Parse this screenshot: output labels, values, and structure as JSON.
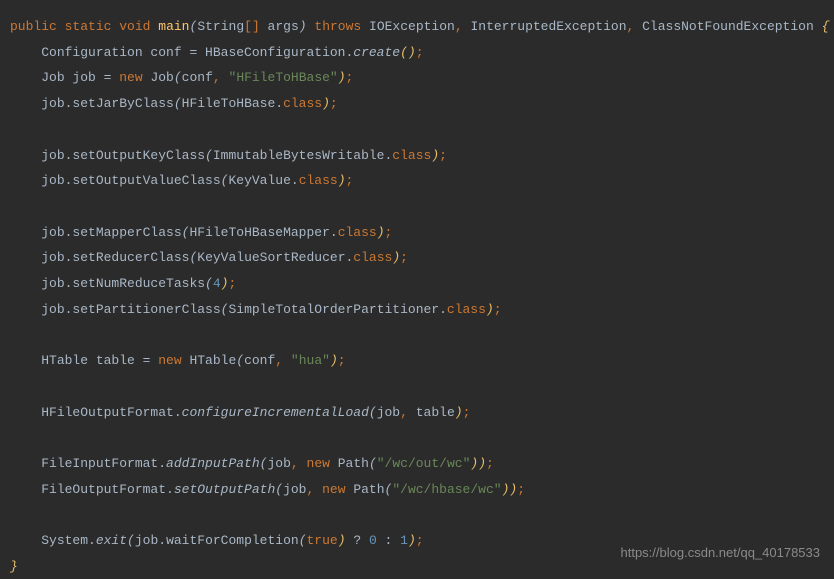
{
  "code": {
    "line1": {
      "public": "public",
      "static": "static",
      "void": "void",
      "main": "main",
      "string": "String",
      "br_open": "[",
      "br_close": "]",
      "args": " args",
      "throws": "throws",
      "ex1": "IOException",
      "ex2": "InterruptedException",
      "ex3": "ClassNotFoundException",
      "brace": "{"
    },
    "line2": {
      "p1": "Configuration conf = HBaseConfiguration.",
      "create": "create",
      "paren": "()"
    },
    "line3": {
      "p1": "Job job = ",
      "new": "new",
      "p2": " Job",
      "lp": "(",
      "conf": "conf",
      "comma": ", ",
      "str": "\"HFileToHBase\"",
      "rp": ")"
    },
    "line4": {
      "p1": "job.setJarByClass",
      "lp": "(",
      "p2": "HFileToHBase.",
      "cls": "class",
      "rp": ")"
    },
    "line5": {
      "p1": "job.setOutputKeyClass",
      "lp": "(",
      "p2": "ImmutableBytesWritable.",
      "cls": "class",
      "rp": ")"
    },
    "line6": {
      "p1": "job.setOutputValueClass",
      "lp": "(",
      "p2": "KeyValue.",
      "cls": "class",
      "rp": ")"
    },
    "line7": {
      "p1": "job.setMapperClass",
      "lp": "(",
      "p2": "HFileToHBaseMapper.",
      "cls": "class",
      "rp": ")"
    },
    "line8": {
      "p1": "job.setReducerClass",
      "lp": "(",
      "p2": "KeyValueSortReducer.",
      "cls": "class",
      "rp": ")"
    },
    "line9": {
      "p1": "job.setNumReduceTasks",
      "lp": "(",
      "num": "4",
      "rp": ")"
    },
    "line10": {
      "p1": "job.setPartitionerClass",
      "lp": "(",
      "p2": "SimpleTotalOrderPartitioner.",
      "cls": "class",
      "rp": ")"
    },
    "line11": {
      "p1": "HTable table = ",
      "new": "new",
      "p2": " HTable",
      "lp": "(",
      "conf": "conf",
      "comma": ", ",
      "str": "\"hua\"",
      "rp": ")"
    },
    "line12": {
      "p1": "HFileOutputFormat.",
      "m": "configureIncrementalLoad",
      "lp": "(",
      "args": "job",
      "comma": ", ",
      "args2": "table",
      "rp": ")"
    },
    "line13": {
      "p1": "FileInputFormat.",
      "m": "addInputPath",
      "lp": "(",
      "job": "job",
      "comma": ", ",
      "new": "new",
      "path": " Path",
      "lp2": "(",
      "str": "\"/wc/out/wc\"",
      "rp2": ")",
      "rp": ")"
    },
    "line14": {
      "p1": "FileOutputFormat.",
      "m": "setOutputPath",
      "lp": "(",
      "job": "job",
      "comma": ", ",
      "new": "new",
      "path": " Path",
      "lp2": "(",
      "str": "\"/wc/hbase/wc\"",
      "rp2": ")",
      "rp": ")"
    },
    "line15": {
      "p1": "System.",
      "m": "exit",
      "lp": "(",
      "p2": "job.waitForCompletion",
      "lp2": "(",
      "true": "true",
      "rp2": ")",
      "q": " ? ",
      "n0": "0",
      "colon": " : ",
      "n1": "1",
      "rp": ")"
    },
    "close_brace": "}",
    "semi": ";",
    "comma": ","
  },
  "watermark": "https://blog.csdn.net/qq_40178533"
}
